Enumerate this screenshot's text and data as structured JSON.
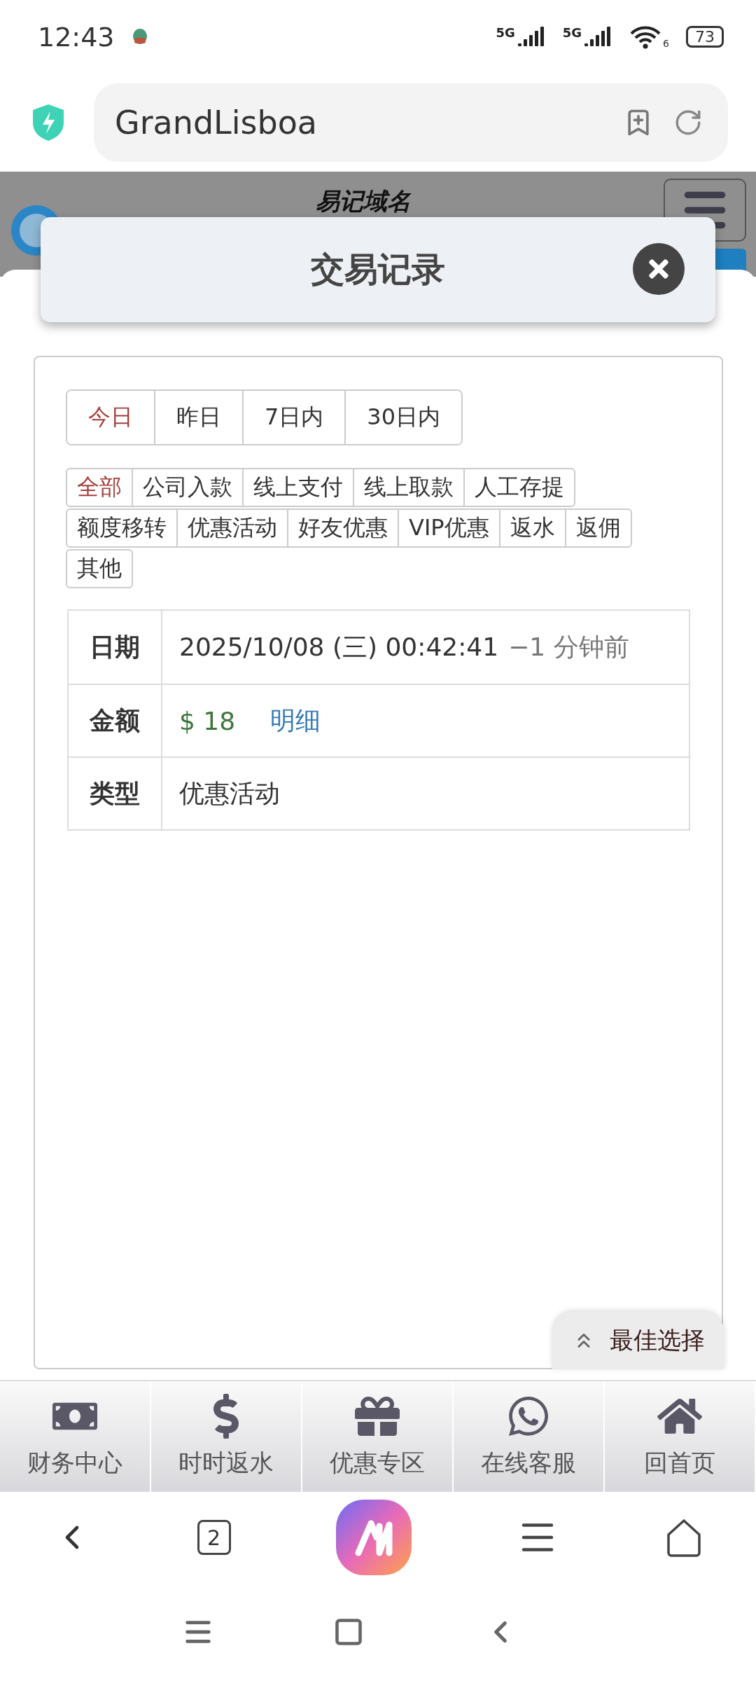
{
  "status_bar": {
    "time": "12:43",
    "network_labels": [
      "5G",
      "5G"
    ],
    "wifi_badge": "6",
    "battery": "73"
  },
  "browser": {
    "address": "GrandLisboa",
    "tab_count": "2"
  },
  "site_header": {
    "tagline": "易记域名"
  },
  "modal": {
    "title": "交易记录"
  },
  "date_tabs": [
    {
      "label": "今日",
      "selected": true
    },
    {
      "label": "昨日",
      "selected": false
    },
    {
      "label": "7日内",
      "selected": false
    },
    {
      "label": "30日内",
      "selected": false
    }
  ],
  "type_filters": [
    {
      "label": "全部",
      "selected": true
    },
    {
      "label": "公司入款",
      "selected": false
    },
    {
      "label": "线上支付",
      "selected": false
    },
    {
      "label": "线上取款",
      "selected": false
    },
    {
      "label": "人工存提",
      "selected": false
    },
    {
      "label": "额度移转",
      "selected": false
    },
    {
      "label": "优惠活动",
      "selected": false
    },
    {
      "label": "好友优惠",
      "selected": false
    },
    {
      "label": "VIP优惠",
      "selected": false
    },
    {
      "label": "返水",
      "selected": false
    },
    {
      "label": "返佣",
      "selected": false
    },
    {
      "label": "其他",
      "selected": false
    }
  ],
  "record": [
    {
      "label": "日期",
      "kind": "date",
      "value": "2025/10/08 (三) 00:42:41",
      "note": "−1 分钟前"
    },
    {
      "label": "金额",
      "kind": "amount",
      "value": "$ 18",
      "link": "明细"
    },
    {
      "label": "类型",
      "kind": "text",
      "value": "优惠活动"
    }
  ],
  "floating_button": {
    "label": "最佳选择"
  },
  "bottom_nav": [
    {
      "label": "财务中心"
    },
    {
      "label": "时时返水"
    },
    {
      "label": "优惠专区"
    },
    {
      "label": "在线客服"
    },
    {
      "label": "回首页"
    }
  ]
}
